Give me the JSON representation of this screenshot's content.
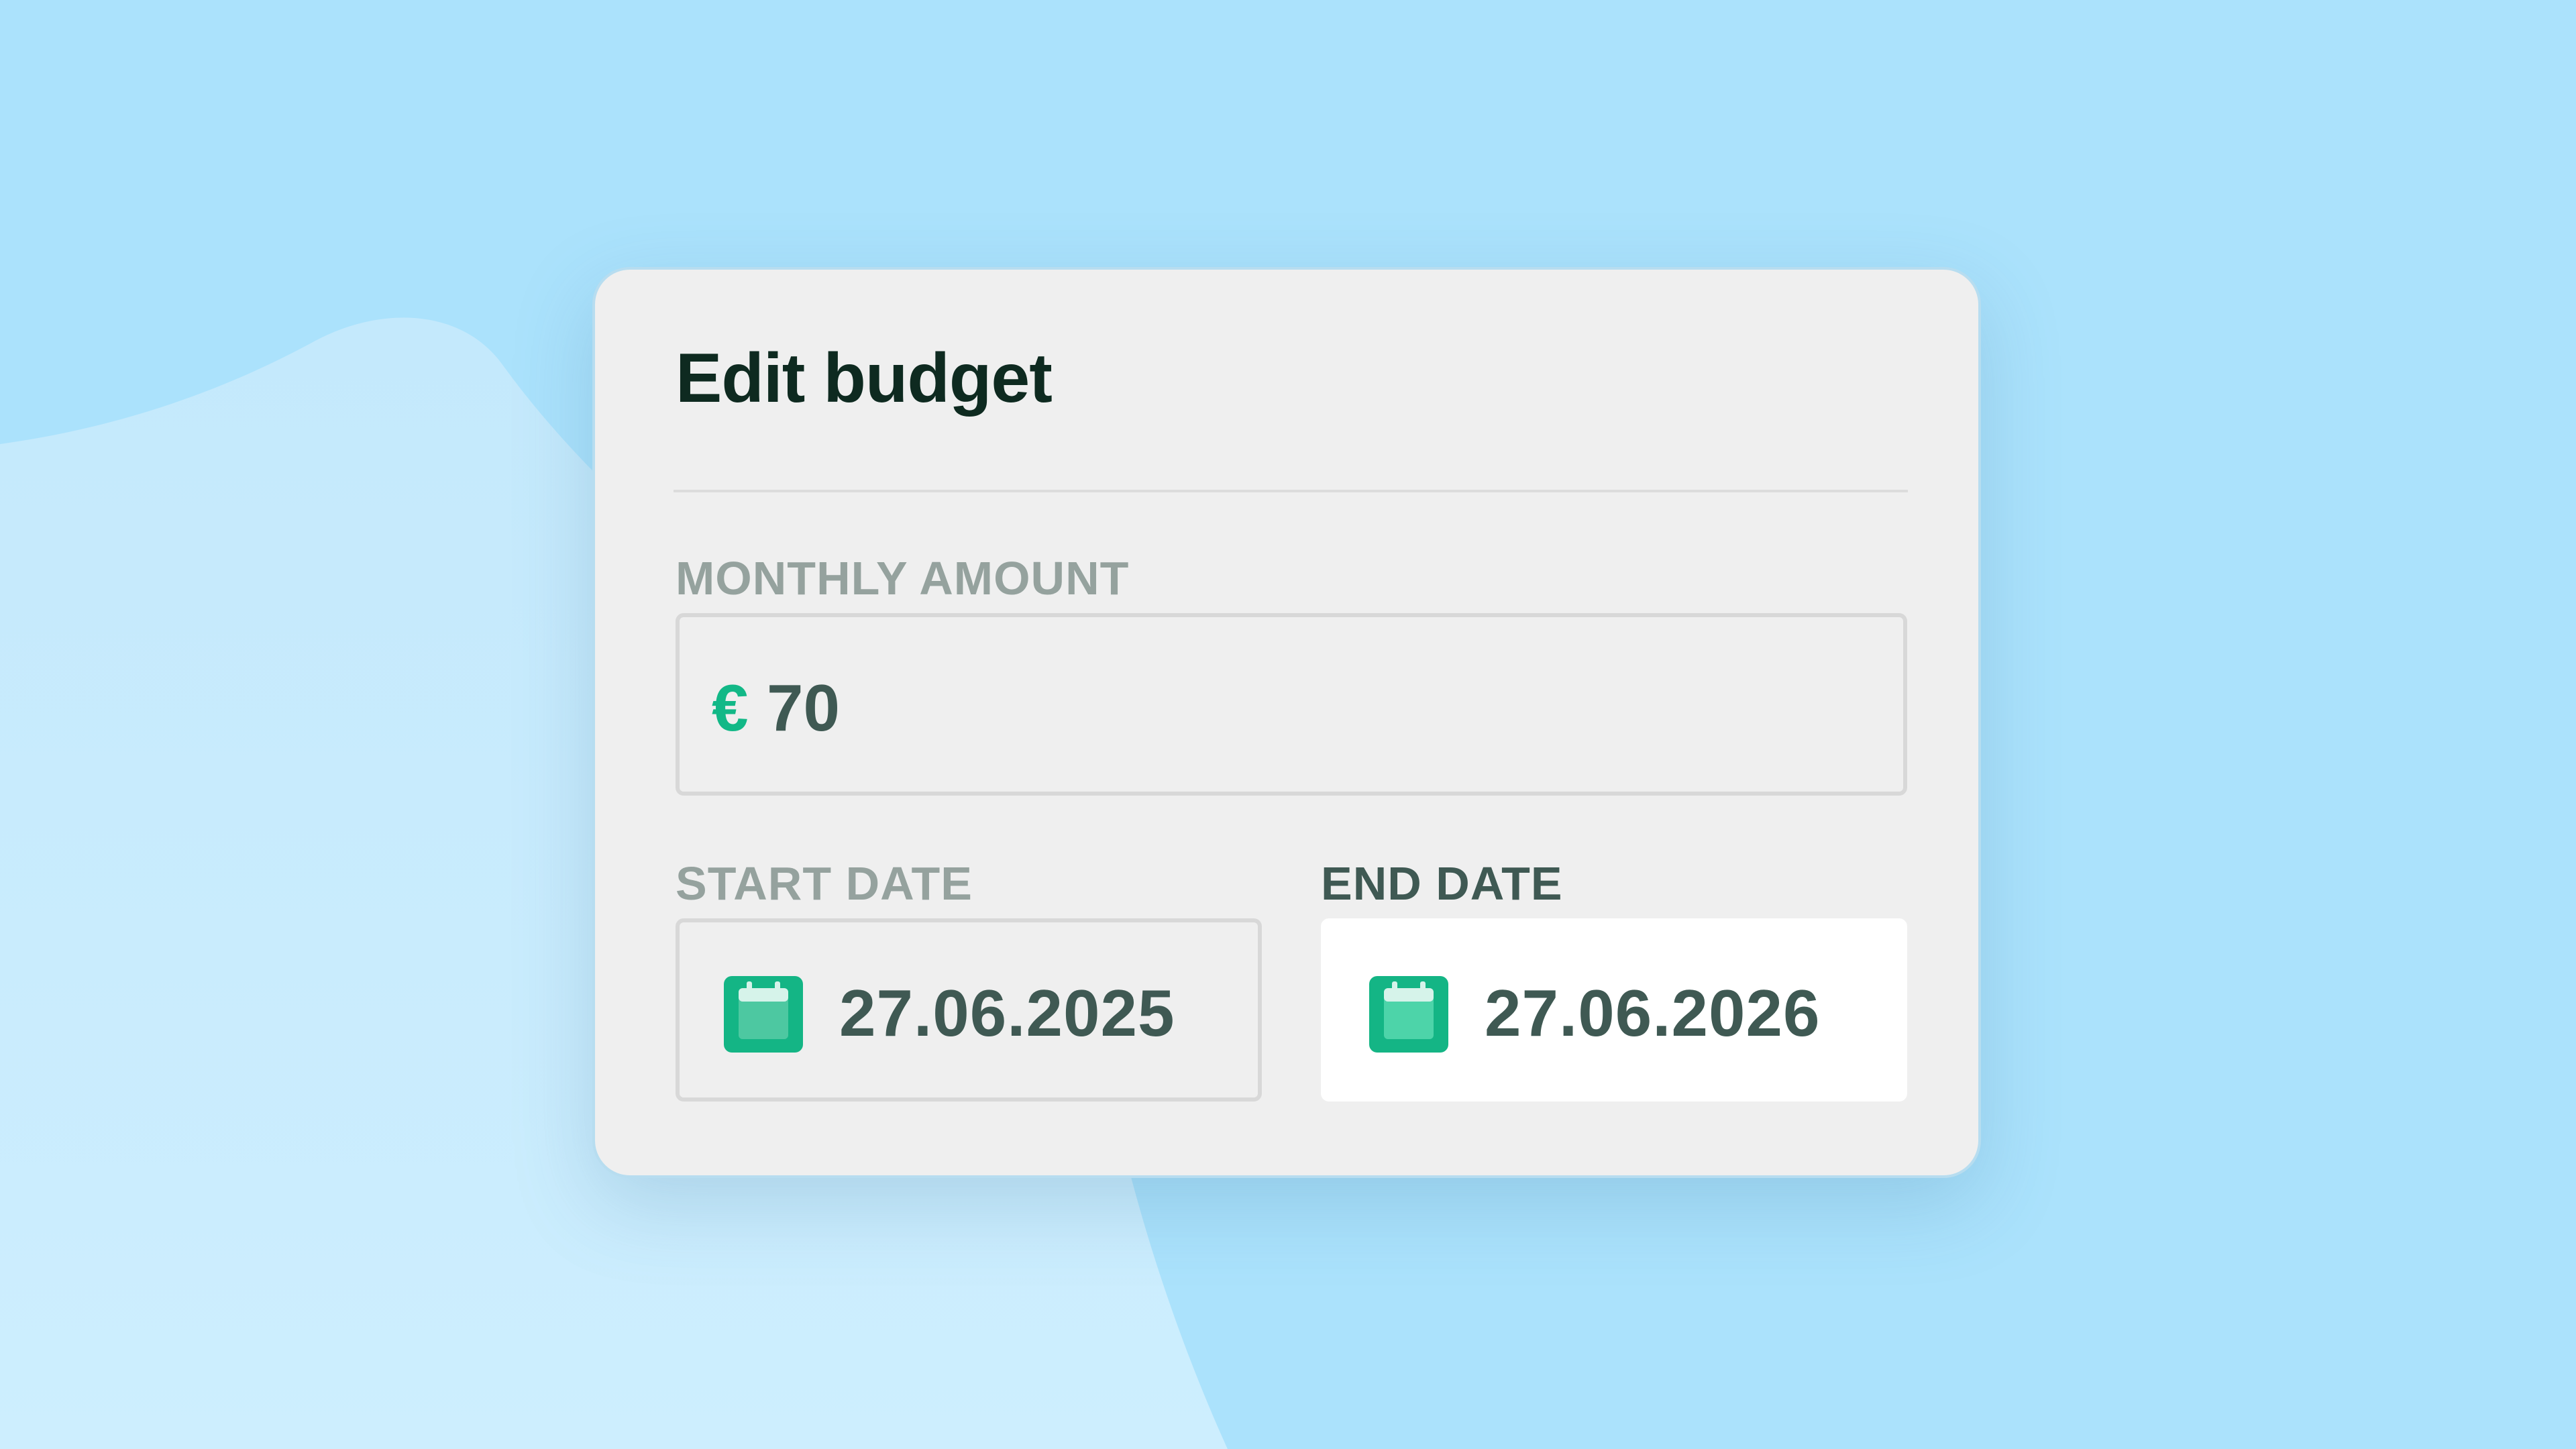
{
  "dialog": {
    "title": "Edit budget"
  },
  "monthly_amount": {
    "label": "MONTHLY AMOUNT",
    "currency_symbol": "€",
    "value": "70"
  },
  "start_date": {
    "label": "START DATE",
    "value": "27.06.2025",
    "icon": "calendar-icon"
  },
  "end_date": {
    "label": "END DATE",
    "value": "27.06.2026",
    "icon": "calendar-icon"
  },
  "colors": {
    "background": "#abe2fc",
    "card": "#efefef",
    "accent_green": "#12b887",
    "title_text": "#0e2a20",
    "value_text": "#3f5953",
    "muted_label": "#95a29e"
  }
}
